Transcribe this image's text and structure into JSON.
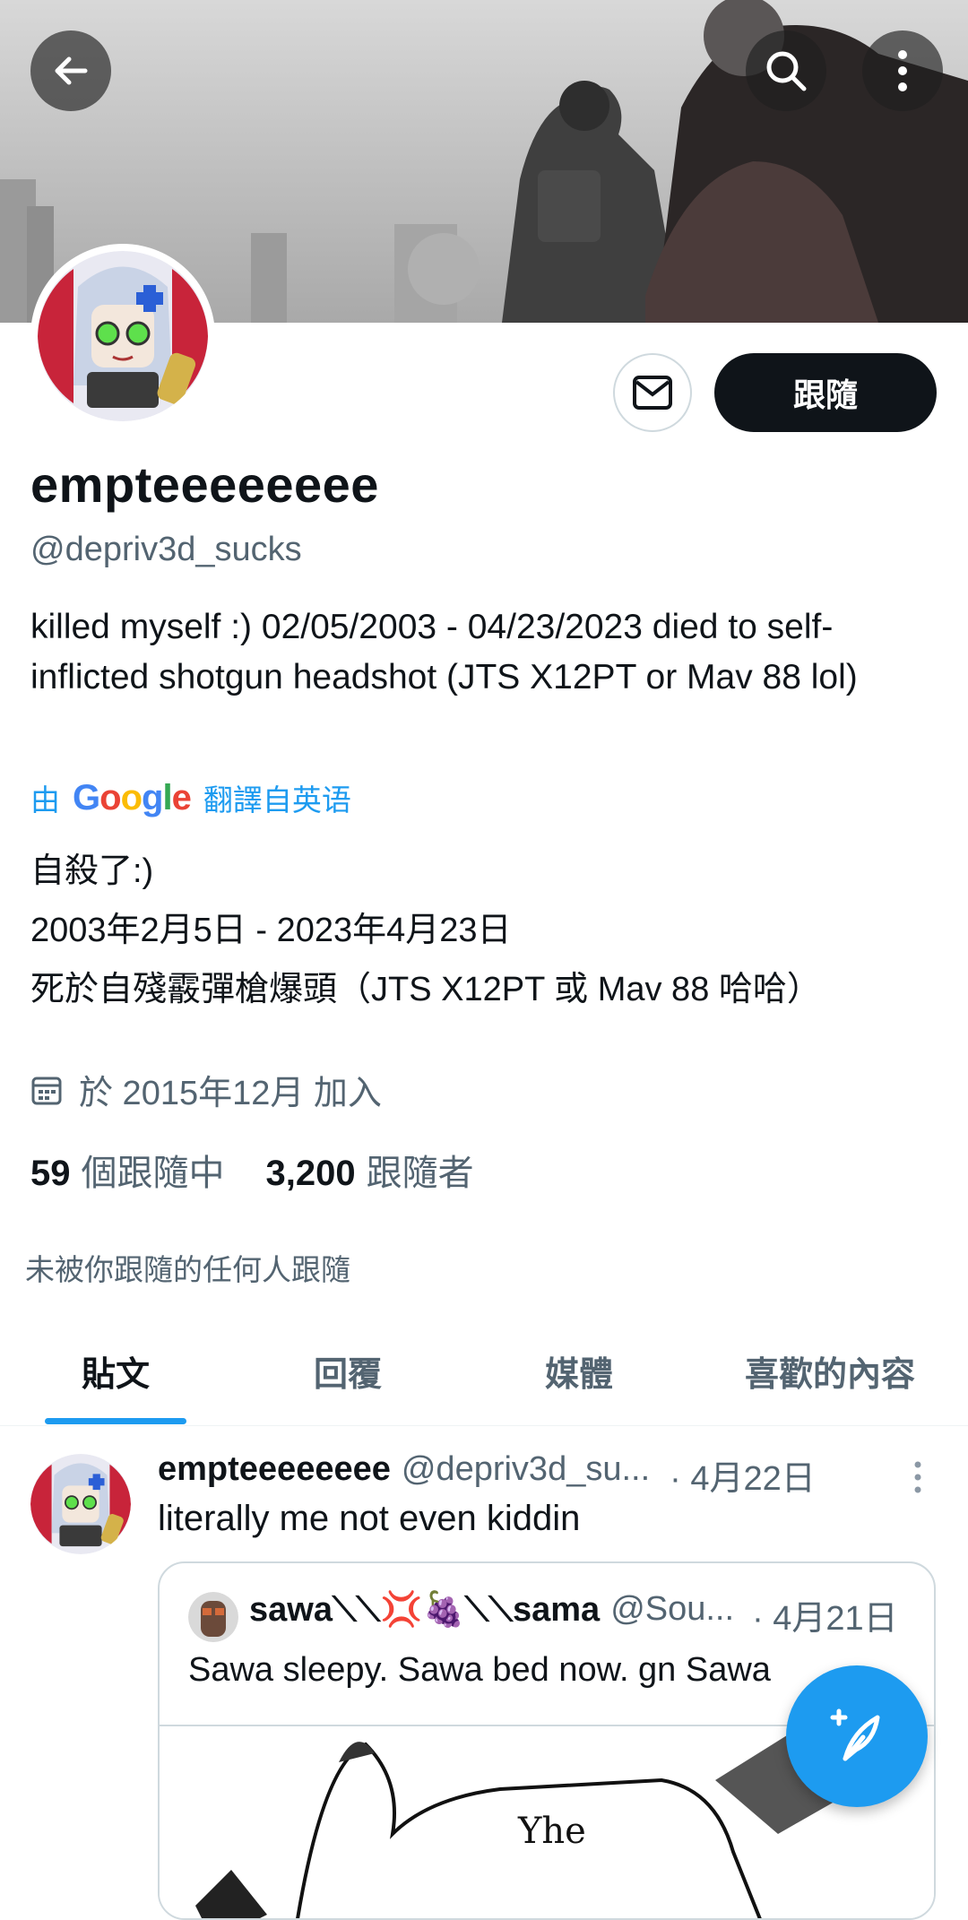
{
  "profile": {
    "display_name": "empteeeeeeee",
    "handle": "@depriv3d_sucks",
    "bio": "killed myself :) 02/05/2003 - 04/23/2023 died to self-inflicted shotgun headshot (JTS X12PT or Mav 88 lol)",
    "translation": {
      "prefix": "由",
      "provider": "Google",
      "suffix": "翻譯自英语",
      "lines": [
        "自殺了:)",
        "2003年2月5日 - 2023年4月23日",
        "死於自殘霰彈槍爆頭（JTS X12PT 或 Mav 88 哈哈）"
      ]
    },
    "joined": "於 2015年12月 加入",
    "following_count": "59",
    "following_label": "個跟隨中",
    "followers_count": "3,200",
    "followers_label": "跟隨者",
    "not_followed_note": "未被你跟隨的任何人跟隨"
  },
  "actions": {
    "follow_label": "跟隨"
  },
  "tabs": [
    {
      "label": "貼文",
      "active": true
    },
    {
      "label": "回覆",
      "active": false
    },
    {
      "label": "媒體",
      "active": false
    },
    {
      "label": "喜歡的內容",
      "active": false
    }
  ],
  "post": {
    "name": "empteeeeeeee",
    "handle": "@depriv3d_su...",
    "date": "· 4月22日",
    "text": "literally me not even kiddin",
    "quote": {
      "name": "sawa⟍⟍💢🍇⟍⟍sama",
      "handle": "@Sou...",
      "date": "· 4月21日",
      "text": "Sawa sleepy. Sawa bed now. gn Sawa"
    }
  },
  "colors": {
    "accent": "#1d9bf0",
    "text_primary": "#0f1419",
    "text_secondary": "#536471",
    "border": "#cfd9de"
  },
  "icons": [
    "back-arrow-icon",
    "search-icon",
    "more-vertical-icon",
    "mail-icon",
    "calendar-icon",
    "compose-icon"
  ]
}
